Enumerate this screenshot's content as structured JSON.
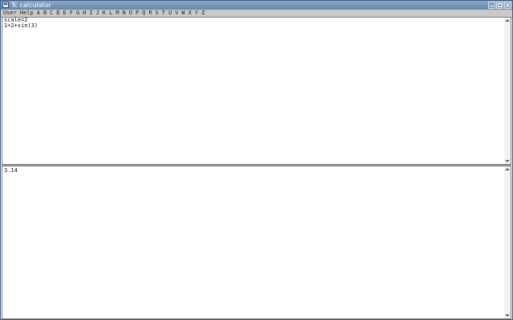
{
  "window": {
    "title": "Tc calculator"
  },
  "menubar": {
    "items": [
      "User",
      "Help",
      "A",
      "B",
      "C",
      "D",
      "E",
      "F",
      "G",
      "H",
      "I",
      "J",
      "K",
      "L",
      "M",
      "N",
      "O",
      "P",
      "Q",
      "R",
      "S",
      "T",
      "U",
      "V",
      "W",
      "X",
      "Y",
      "Z"
    ]
  },
  "input_pane": {
    "lines": [
      "scale=2",
      "1+2+sin(3)"
    ]
  },
  "output_pane": {
    "lines": [
      "3.14"
    ]
  },
  "icons": {
    "app": "calculator-icon",
    "minimize": "minimize-icon",
    "maximize": "maximize-icon",
    "close": "close-icon"
  },
  "colors": {
    "titlebar": "#6f8bb2",
    "menubar": "#c9c9c9",
    "pane_background": "#ffffff"
  }
}
